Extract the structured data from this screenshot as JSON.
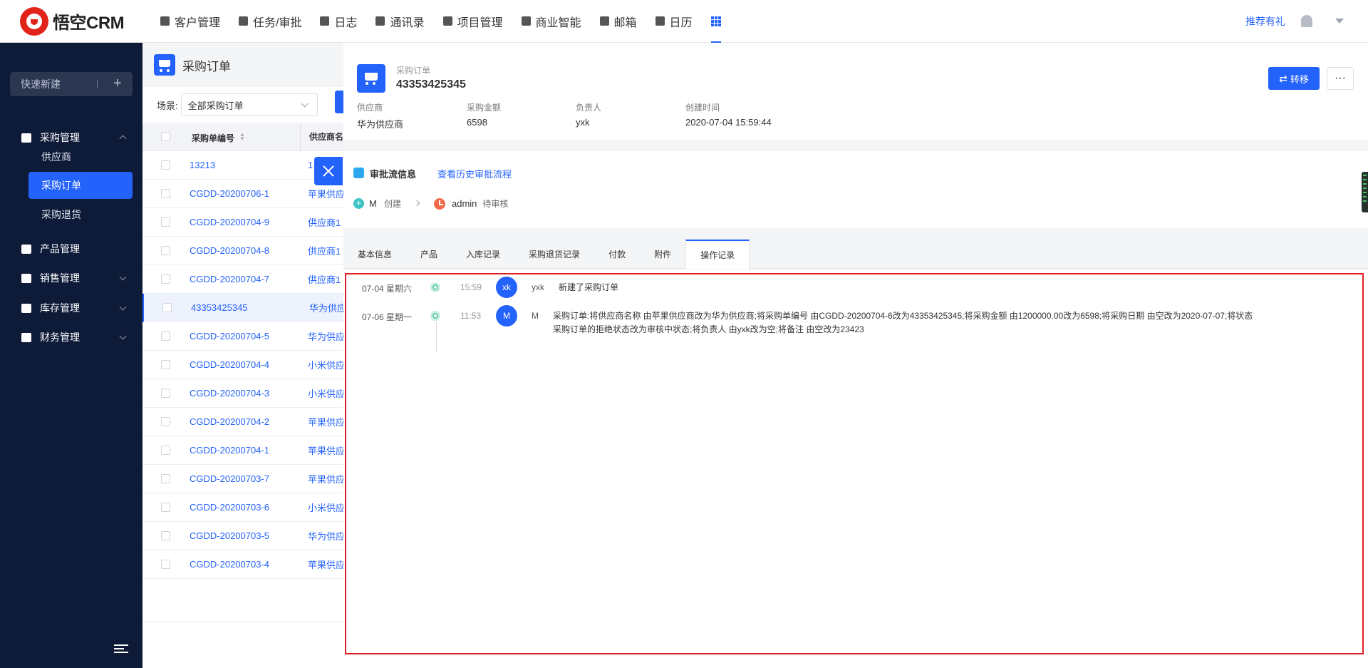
{
  "app": {
    "logo_text": "悟空CRM"
  },
  "nav": {
    "items": [
      "客户管理",
      "任务/审批",
      "日志",
      "通讯录",
      "项目管理",
      "商业智能",
      "邮箱",
      "日历"
    ],
    "recommend": "推荐有礼"
  },
  "sidebar": {
    "quick_new": "快速新建",
    "groups": {
      "purchase": "采购管理",
      "product": "产品管理",
      "sales": "销售管理",
      "inventory": "库存管理",
      "finance": "财务管理"
    },
    "sub_items": [
      "供应商",
      "采购订单",
      "采购退货"
    ]
  },
  "list": {
    "title": "采购订单",
    "scene_label": "场景:",
    "scene_value": "全部采购订单",
    "col_no": "采购单编号",
    "col_supplier": "供应商名",
    "rows": [
      {
        "no": "13213",
        "supplier": "1"
      },
      {
        "no": "CGDD-20200706-1",
        "supplier": "苹果供应"
      },
      {
        "no": "CGDD-20200704-9",
        "supplier": "供应商1"
      },
      {
        "no": "CGDD-20200704-8",
        "supplier": "供应商1"
      },
      {
        "no": "CGDD-20200704-7",
        "supplier": "供应商1"
      },
      {
        "no": "43353425345",
        "supplier": "华为供应"
      },
      {
        "no": "CGDD-20200704-5",
        "supplier": "华为供应"
      },
      {
        "no": "CGDD-20200704-4",
        "supplier": "小米供应"
      },
      {
        "no": "CGDD-20200704-3",
        "supplier": "小米供应"
      },
      {
        "no": "CGDD-20200704-2",
        "supplier": "苹果供应"
      },
      {
        "no": "CGDD-20200704-1",
        "supplier": "苹果供应"
      },
      {
        "no": "CGDD-20200703-7",
        "supplier": "苹果供应"
      },
      {
        "no": "CGDD-20200703-6",
        "supplier": "小米供应"
      },
      {
        "no": "CGDD-20200703-5",
        "supplier": "华为供应"
      },
      {
        "no": "CGDD-20200703-4",
        "supplier": "苹果供应"
      }
    ]
  },
  "detail": {
    "subtitle": "采购订单",
    "title": "43353425345",
    "transfer": "转移",
    "more": "···",
    "fields": [
      {
        "label": "供应商",
        "value": "华为供应商"
      },
      {
        "label": "采购金额",
        "value": "6598"
      },
      {
        "label": "负责人",
        "value": "yxk"
      },
      {
        "label": "创建时间",
        "value": "2020-07-04 15:59:44"
      }
    ],
    "approval": {
      "title": "审批流信息",
      "history_link": "查看历史审批流程",
      "step1_user": "M",
      "step1_status": "创建",
      "step2_user": "admin",
      "step2_status": "待审核"
    },
    "tabs": [
      "基本信息",
      "产品",
      "入库记录",
      "采购退货记录",
      "付款",
      "附件",
      "操作记录"
    ],
    "logs": [
      {
        "date": "07-04 星期六",
        "time": "15:59",
        "avatar": "xk",
        "user": "yxk",
        "text": "新建了采购订单",
        "text2": ""
      },
      {
        "date": "07-06 星期一",
        "time": "11:53",
        "avatar": "M",
        "user": "M",
        "text": "采购订单:将供应商名称 由苹果供应商改为华为供应商;将采购单编号 由CGDD-20200704-6改为43353425345;将采购金额 由1200000.00改为6598;将采购日期 由空改为2020-07-07;将状态",
        "text2": "采购订单的拒绝状态改为审核中状态;将负责人 由yxk改为空;将备注 由空改为23423"
      }
    ]
  }
}
